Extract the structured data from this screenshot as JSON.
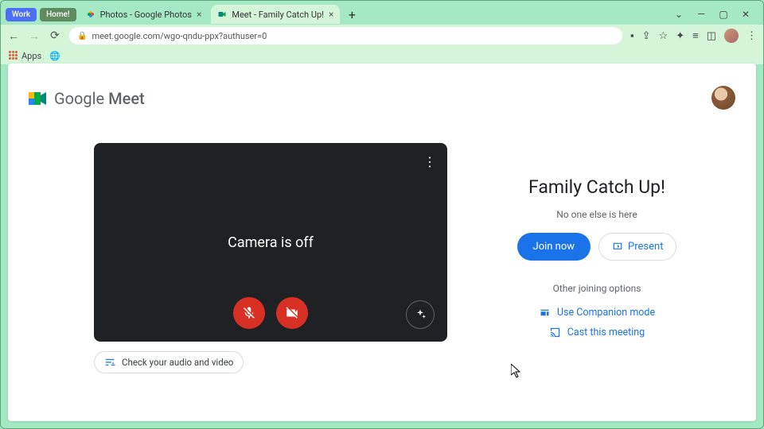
{
  "browser": {
    "badges": {
      "work": "Work",
      "home": "Home!"
    },
    "tabs": [
      {
        "title": "Photos - Google Photos",
        "active": false
      },
      {
        "title": "Meet - Family Catch Up!",
        "active": true
      }
    ],
    "url": "meet.google.com/wgo-qndu-ppx?authuser=0",
    "apps_label": "Apps"
  },
  "header": {
    "brand_first": "Google",
    "brand_second": "Meet"
  },
  "preview": {
    "camera_off": "Camera is off"
  },
  "check_audio": "Check your audio and video",
  "meeting": {
    "title": "Family Catch Up!",
    "status": "No one else is here",
    "join": "Join now",
    "present": "Present",
    "other_label": "Other joining options",
    "companion": "Use Companion mode",
    "cast": "Cast this meeting"
  }
}
